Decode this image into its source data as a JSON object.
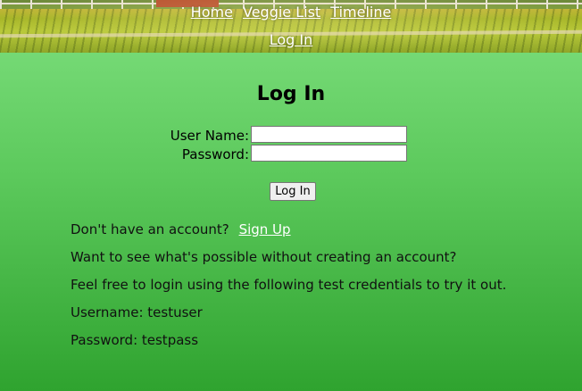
{
  "nav": {
    "home": "Home",
    "veggie_list": "Veggie List",
    "timeline": "Timeline",
    "login": "Log In"
  },
  "page_title": "Log In",
  "form": {
    "username_label": "User Name:",
    "username_value": "",
    "password_label": "Password:",
    "password_value": "",
    "submit_label": "Log In"
  },
  "info": {
    "no_account": "Don't have an account?",
    "signup_link": "Sign Up",
    "try_it": "Want to see what's possible without creating an account?",
    "test_creds": "Feel free to login using the following test credentials to try it out.",
    "username_line": "Username: testuser",
    "password_line": "Password: testpass"
  },
  "colors": {
    "gradient_top": "#7fe07f",
    "gradient_bottom": "#2fa32f",
    "link": "#ffffff"
  }
}
